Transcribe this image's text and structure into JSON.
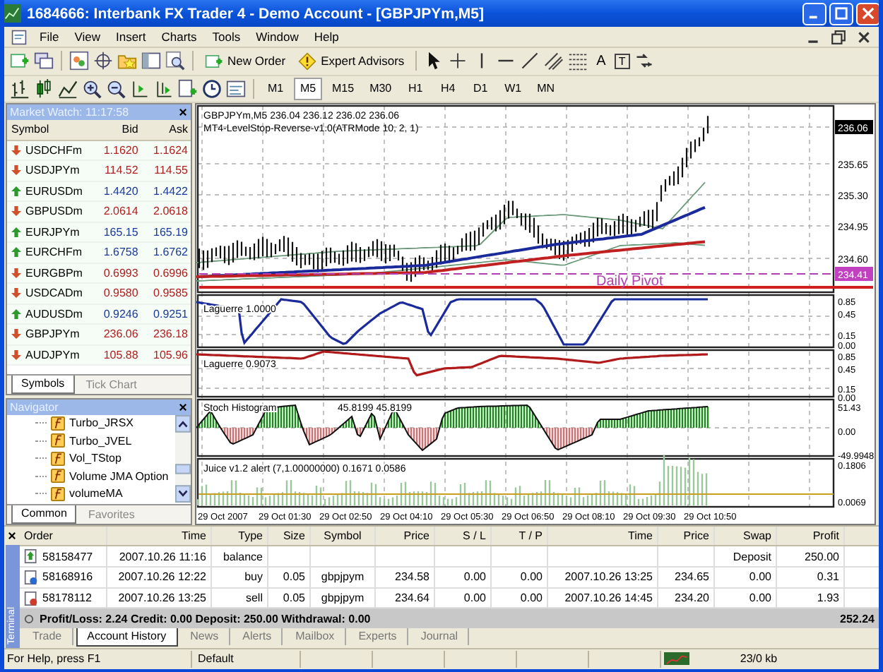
{
  "window": {
    "title": "1684666: Interbank FX Trader 4 - Demo Account - [GBPJPYm,M5]"
  },
  "menu": [
    "File",
    "View",
    "Insert",
    "Charts",
    "Tools",
    "Window",
    "Help"
  ],
  "toolbar": {
    "buttons": [
      {
        "label": "New Order",
        "kind": "order"
      },
      {
        "label": "Expert Advisors",
        "kind": "experts"
      }
    ],
    "text_tools": [
      "A",
      "T"
    ]
  },
  "timeframes": [
    {
      "label": "M1",
      "selected": false
    },
    {
      "label": "M5",
      "selected": true
    },
    {
      "label": "M15",
      "selected": false
    },
    {
      "label": "M30",
      "selected": false
    },
    {
      "label": "H1",
      "selected": false
    },
    {
      "label": "H4",
      "selected": false
    },
    {
      "label": "D1",
      "selected": false
    },
    {
      "label": "W1",
      "selected": false
    },
    {
      "label": "MN",
      "selected": false
    }
  ],
  "market_watch": {
    "title": "Market Watch: 11:17:58",
    "columns": [
      "Symbol",
      "Bid",
      "Ask"
    ],
    "rows": [
      {
        "symbol": "USDCHFm",
        "bid": "1.1620",
        "ask": "1.1624",
        "kind": "down"
      },
      {
        "symbol": "USDJPYm",
        "bid": "114.52",
        "ask": "114.55",
        "kind": "down"
      },
      {
        "symbol": "EURUSDm",
        "bid": "1.4420",
        "ask": "1.4422",
        "kind": "up"
      },
      {
        "symbol": "GBPUSDm",
        "bid": "2.0614",
        "ask": "2.0618",
        "kind": "down"
      },
      {
        "symbol": "EURJPYm",
        "bid": "165.15",
        "ask": "165.19",
        "kind": "up"
      },
      {
        "symbol": "EURCHFm",
        "bid": "1.6758",
        "ask": "1.6762",
        "kind": "up"
      },
      {
        "symbol": "EURGBPm",
        "bid": "0.6993",
        "ask": "0.6996",
        "kind": "down"
      },
      {
        "symbol": "USDCADm",
        "bid": "0.9580",
        "ask": "0.9585",
        "kind": "down"
      },
      {
        "symbol": "AUDUSDm",
        "bid": "0.9246",
        "ask": "0.9251",
        "kind": "up"
      },
      {
        "symbol": "GBPJPYm",
        "bid": "236.06",
        "ask": "236.18",
        "kind": "down"
      },
      {
        "symbol": "AUDJPYm",
        "bid": "105.88",
        "ask": "105.96",
        "kind": "down"
      }
    ],
    "tabs": [
      {
        "label": "Symbols",
        "selected": true
      },
      {
        "label": "Tick Chart",
        "selected": false
      }
    ]
  },
  "navigator": {
    "title": "Navigator",
    "items": [
      "Turbo_JRSX",
      "Turbo_JVEL",
      "Vol_TStop",
      "Volume JMA Option",
      "volumeMA"
    ],
    "tabs": [
      {
        "label": "Common",
        "selected": true
      },
      {
        "label": "Favorites",
        "selected": false
      }
    ]
  },
  "chart": {
    "header": "GBPJPYm,M5  236.04 236.12 236.02 236.06",
    "indicator": "MT4-LevelStop-Reverse-v1.0(ATRMode 10, 2, 1)",
    "current_price": "236.06",
    "price_ticks": [
      "235.65",
      "235.30",
      "234.95",
      "234.60"
    ],
    "pivot_price": "234.41",
    "pivot_label": "Daily Pivot",
    "laguerre_1": {
      "label": "Laguerre 1.0000",
      "ticks": [
        "0.85",
        "0.45",
        "0.15",
        "0.00"
      ]
    },
    "laguerre_2": {
      "label": "Laguerre 0.9073",
      "ticks": [
        "0.85",
        "0.45",
        "0.15",
        "0.00"
      ]
    },
    "stoch": {
      "label": "Stoch Histogram",
      "values": "45.8199 45.8199",
      "ticks": [
        "51.43",
        "0.00",
        "-49.9948"
      ]
    },
    "juice": {
      "label": "Juice v1.2 alert (7,1.00000000) 0.1671 0.0586",
      "ticks": [
        "0.1806",
        "0.0069"
      ]
    },
    "time_labels": [
      "29 Oct 2007",
      "29 Oct 01:30",
      "29 Oct 02:50",
      "29 Oct 04:10",
      "29 Oct 05:30",
      "29 Oct 06:50",
      "29 Oct 08:10",
      "29 Oct 09:30",
      "29 Oct 10:50"
    ]
  },
  "terminal": {
    "side_label": "Terminal",
    "columns": [
      "Order",
      "Time",
      "Type",
      "Size",
      "Symbol",
      "Price",
      "S / L",
      "T / P",
      "Time",
      "Price",
      "Swap",
      "Profit"
    ],
    "rows": [
      {
        "kind": "balance",
        "order": "58158477",
        "open_time": "2007.10.26 11:16",
        "type": "balance",
        "swap": "Deposit",
        "profit": "250.00"
      },
      {
        "kind": "buy",
        "order": "58168916",
        "open_time": "2007.10.26 12:22",
        "type": "buy",
        "size": "0.05",
        "symbol": "gbpjpym",
        "open_price": "234.58",
        "sl": "0.00",
        "tp": "0.00",
        "close_time": "2007.10.26 13:25",
        "close_price": "234.65",
        "swap": "0.00",
        "profit": "0.31"
      },
      {
        "kind": "sell",
        "order": "58178112",
        "open_time": "2007.10.26 13:25",
        "type": "sell",
        "size": "0.05",
        "symbol": "gbpjpym",
        "open_price": "234.64",
        "sl": "0.00",
        "tp": "0.00",
        "close_time": "2007.10.26 14:45",
        "close_price": "234.20",
        "swap": "0.00",
        "profit": "1.93"
      }
    ],
    "summary": "Profit/Loss: 2.24  Credit: 0.00  Deposit: 250.00  Withdrawal: 0.00",
    "total": "252.24",
    "tabs": [
      {
        "label": "Trade",
        "selected": false
      },
      {
        "label": "Account History",
        "selected": true
      },
      {
        "label": "News",
        "selected": false
      },
      {
        "label": "Alerts",
        "selected": false
      },
      {
        "label": "Mailbox",
        "selected": false
      },
      {
        "label": "Experts",
        "selected": false
      },
      {
        "label": "Journal",
        "selected": false
      }
    ]
  },
  "status_bar": [
    "For Help, press F1",
    "Default",
    "23/0 kb"
  ]
}
